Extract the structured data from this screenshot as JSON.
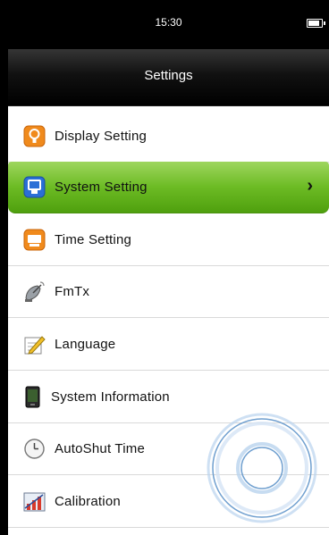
{
  "status_bar": {
    "time": "15:30",
    "battery_level": 0.85
  },
  "header": {
    "title": "Settings"
  },
  "menu": {
    "items": [
      {
        "label": "Display Setting",
        "icon": "display-setting-icon",
        "selected": false
      },
      {
        "label": "System Setting",
        "icon": "system-setting-icon",
        "selected": true
      },
      {
        "label": "Time Setting",
        "icon": "time-setting-icon",
        "selected": false
      },
      {
        "label": "FmTx",
        "icon": "fmtx-satellite-icon",
        "selected": false
      },
      {
        "label": "Language",
        "icon": "language-pencil-icon",
        "selected": false
      },
      {
        "label": "System Information",
        "icon": "system-information-icon",
        "selected": false
      },
      {
        "label": "AutoShut Time",
        "icon": "clock-icon",
        "selected": false
      },
      {
        "label": "Calibration",
        "icon": "calibration-icon",
        "selected": false
      }
    ],
    "chevron": "›"
  },
  "colors": {
    "selected_bg": "#6cbb24",
    "header_bg": "#000000"
  }
}
